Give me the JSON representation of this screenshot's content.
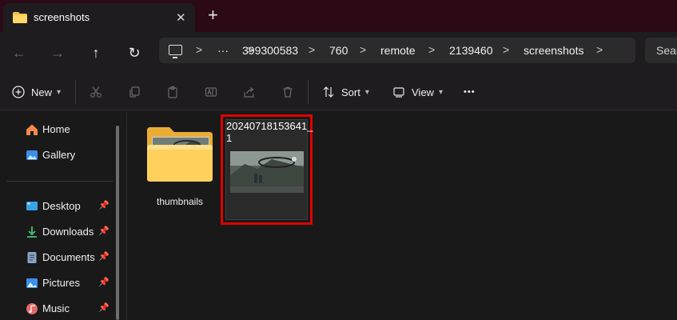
{
  "tab": {
    "title": "screenshots",
    "close": "✕",
    "new_tab": "+"
  },
  "nav": {
    "back": "←",
    "forward": "→",
    "up": "↑",
    "refresh": "↻"
  },
  "address": {
    "more": "···",
    "separator": ">",
    "crumbs": [
      "399300583",
      "760",
      "remote",
      "2139460",
      "screenshots"
    ]
  },
  "search": {
    "placeholder": "Sear"
  },
  "commands": {
    "new_label": "New",
    "sort_label": "Sort",
    "view_label": "View",
    "more": "•••"
  },
  "sidebar": {
    "items": [
      {
        "label": "Home",
        "icon": "home-icon"
      },
      {
        "label": "Gallery",
        "icon": "gallery-icon"
      },
      {
        "label": "Desktop",
        "icon": "desktop-icon",
        "pinned": true
      },
      {
        "label": "Downloads",
        "icon": "downloads-icon",
        "pinned": true
      },
      {
        "label": "Documents",
        "icon": "documents-icon",
        "pinned": true
      },
      {
        "label": "Pictures",
        "icon": "pictures-icon",
        "pinned": true
      },
      {
        "label": "Music",
        "icon": "music-icon",
        "pinned": true
      }
    ],
    "pin_glyph": "📌"
  },
  "files": [
    {
      "name": "thumbnails",
      "kind": "folder"
    },
    {
      "name_line1": "20240718153641_",
      "name_line2": "1",
      "kind": "image",
      "selected": true
    }
  ],
  "colors": {
    "titlebar": "#2b0a15",
    "accent_folder": "#f2c14e",
    "selection_outline": "#e00000"
  }
}
